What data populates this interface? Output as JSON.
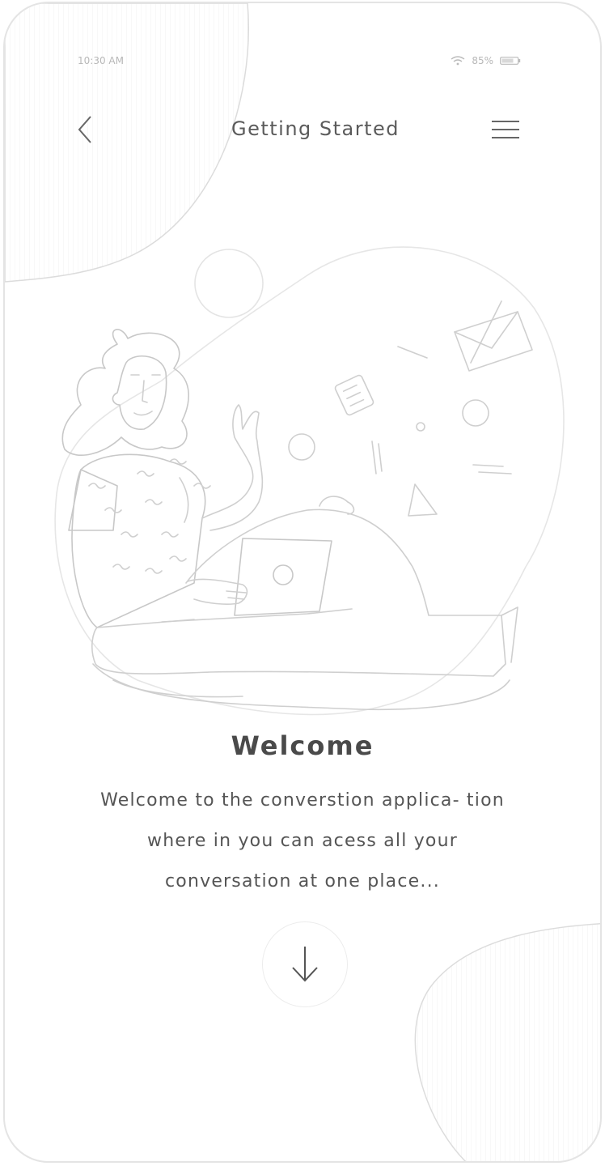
{
  "status_bar": {
    "time": "10:30 AM",
    "battery": "85%",
    "wifi_icon": "wifi-icon",
    "battery_icon": "battery-icon"
  },
  "header": {
    "back_icon": "chevron-left-icon",
    "title": "Getting Started",
    "menu_icon": "hamburger-menu-icon"
  },
  "illustration": {
    "name": "woman-with-laptop-illustration"
  },
  "content": {
    "heading": "Welcome",
    "description": "Welcome to the converstion applica- tion where in you can acess all your conversation at one place..."
  },
  "next_button": {
    "icon": "arrow-down-icon"
  },
  "colors": {
    "background": "#ffffff",
    "stroke": "#d0d0d0",
    "text": "#555555"
  }
}
